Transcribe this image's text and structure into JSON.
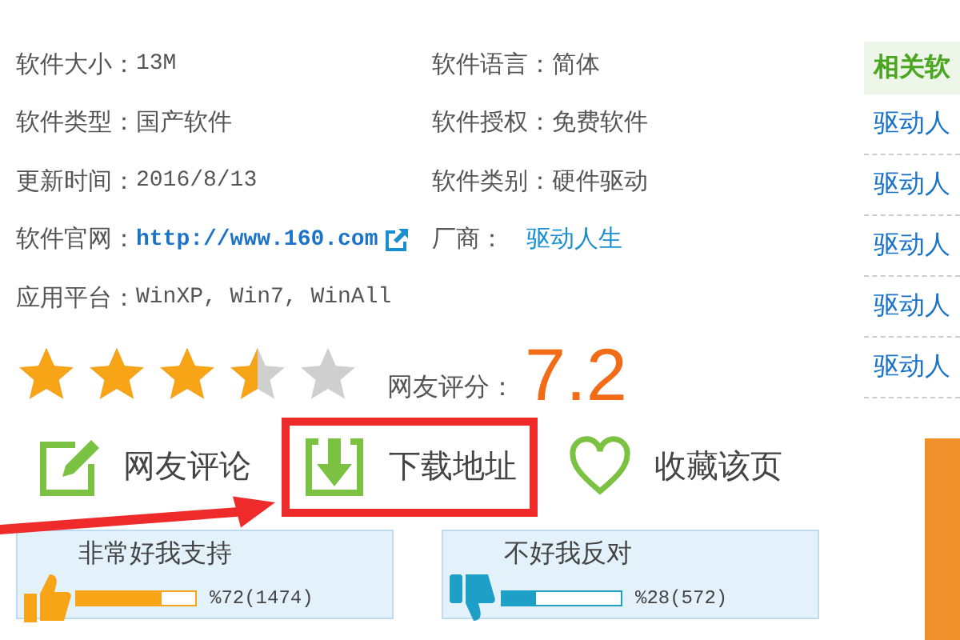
{
  "info": [
    [
      {
        "label": "软件大小：",
        "value": "13M",
        "kind": "text"
      },
      {
        "label": "软件语言：",
        "value": "简体",
        "kind": "text"
      }
    ],
    [
      {
        "label": "软件类型：",
        "value": "国产软件",
        "kind": "text"
      },
      {
        "label": "软件授权：",
        "value": "免费软件",
        "kind": "text"
      }
    ],
    [
      {
        "label": "更新时间：",
        "value": "2016/8/13",
        "kind": "text"
      },
      {
        "label": "软件类别：",
        "value": "硬件驱动",
        "kind": "text"
      }
    ],
    [
      {
        "label": "软件官网：",
        "value": "http://www.160.com",
        "kind": "external_link"
      },
      {
        "label": "厂商：",
        "value": "驱动人生",
        "kind": "link"
      }
    ],
    [
      {
        "label": "应用平台：",
        "value": "WinXP, Win7, WinAll",
        "kind": "text"
      }
    ]
  ],
  "rating": {
    "stars": 3.5,
    "label": "网友评分：",
    "score": "7.2"
  },
  "actions": [
    {
      "kind": "comment",
      "label": "网友评论",
      "highlighted": false
    },
    {
      "kind": "download",
      "label": "下载地址",
      "highlighted": true
    },
    {
      "kind": "favorite",
      "label": "收藏该页",
      "highlighted": false
    }
  ],
  "votes": [
    {
      "kind": "up",
      "label": "非常好我支持",
      "level": 0.72,
      "reading": "%72(1474)"
    },
    {
      "kind": "down",
      "label": "不好我反对",
      "level": 0.28,
      "reading": "%28(572)"
    }
  ],
  "sidebar": {
    "heading": "相关软",
    "items": [
      "驱动人",
      "驱动人",
      "驱动人",
      "驱动人",
      "驱动人"
    ]
  }
}
